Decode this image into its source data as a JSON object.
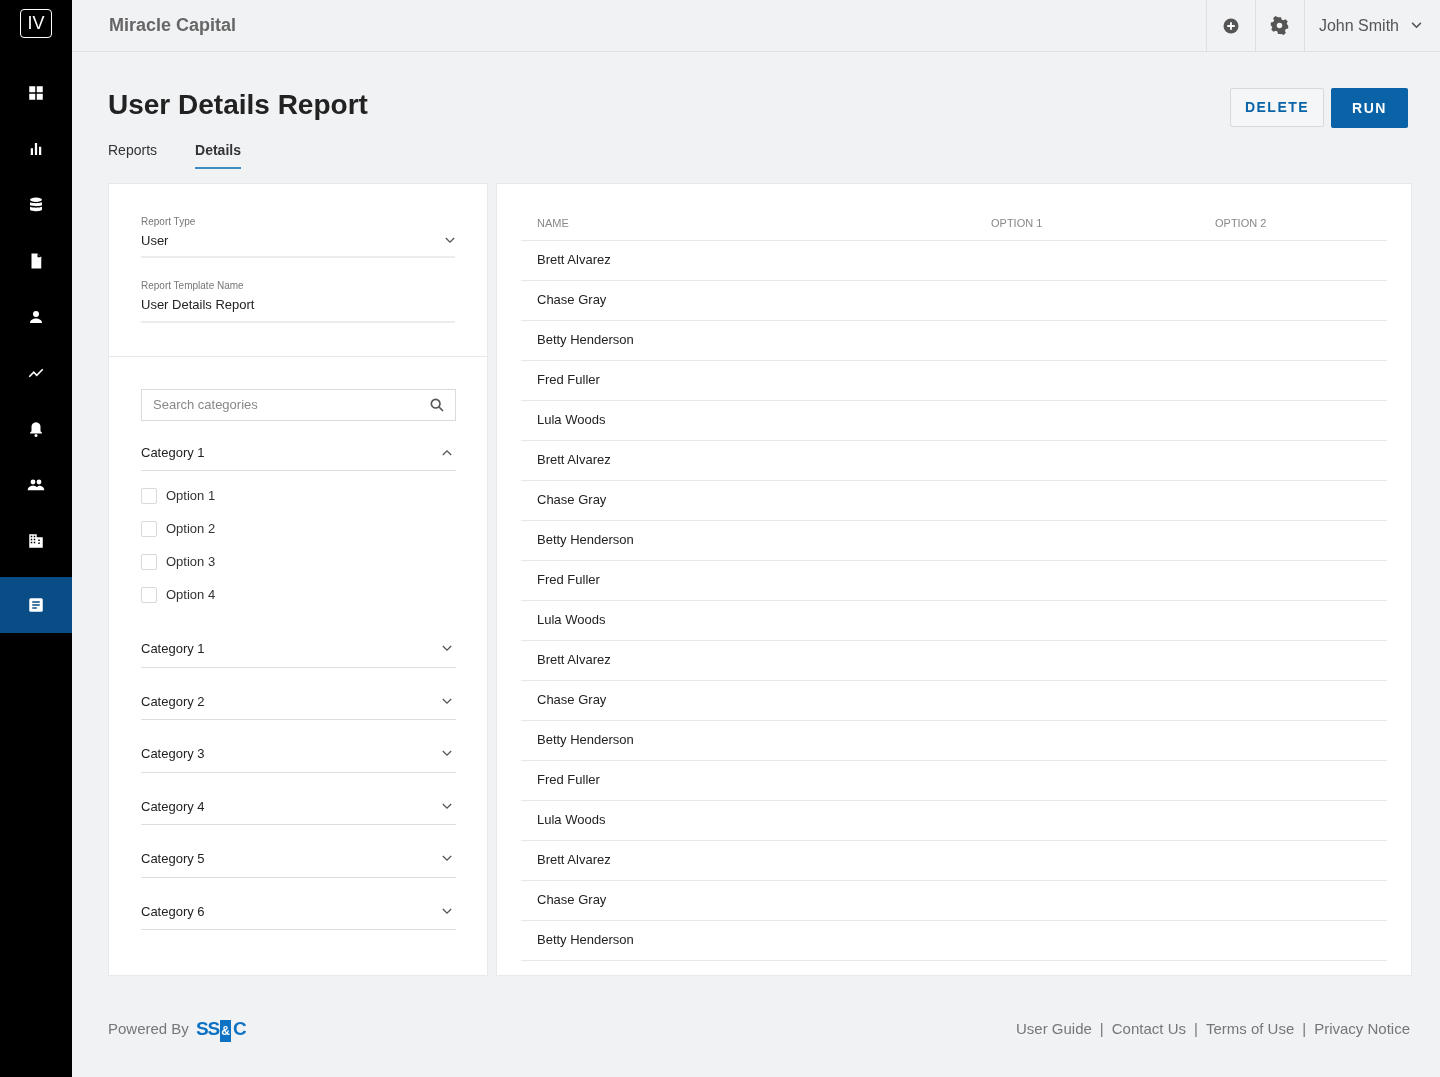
{
  "sidebar": {
    "logo": "IV",
    "items": [
      {
        "selected": false
      },
      {
        "selected": false
      },
      {
        "selected": false
      },
      {
        "selected": false
      },
      {
        "selected": false
      },
      {
        "selected": false
      },
      {
        "selected": false
      },
      {
        "selected": false
      },
      {
        "selected": false
      },
      {
        "selected": true
      }
    ]
  },
  "topbar": {
    "company": "Miracle Capital",
    "user": "John Smith"
  },
  "page": {
    "title": "User Details Report",
    "buttons": [
      {
        "label": "DELETE",
        "kind": "outline"
      },
      {
        "label": "RUN",
        "kind": "primary"
      }
    ]
  },
  "tabs": [
    {
      "label": "Reports",
      "selected": false
    },
    {
      "label": "Details",
      "selected": true
    }
  ],
  "form": {
    "fields": [
      {
        "label": "Report Type",
        "value": "User",
        "kind": "select"
      },
      {
        "label": "Report Template Name",
        "value": "User Details Report",
        "kind": "text"
      }
    ]
  },
  "search": {
    "placeholder": "Search categories"
  },
  "categories": [
    {
      "label": "Category 1",
      "expanded": true,
      "options": [
        {
          "label": "Option 1",
          "checked": false
        },
        {
          "label": "Option 2",
          "checked": false
        },
        {
          "label": "Option 3",
          "checked": false
        },
        {
          "label": "Option 4",
          "checked": false
        }
      ]
    },
    {
      "label": "Category 1",
      "expanded": false
    },
    {
      "label": "Category 2",
      "expanded": false
    },
    {
      "label": "Category 3",
      "expanded": false
    },
    {
      "label": "Category 4",
      "expanded": false
    },
    {
      "label": "Category 5",
      "expanded": false
    },
    {
      "label": "Category 6",
      "expanded": false
    }
  ],
  "table": {
    "columns": [
      "NAME",
      "OPTION 1",
      "OPTION 2"
    ],
    "rows": [
      {
        "name": "Brett Alvarez"
      },
      {
        "name": "Chase Gray"
      },
      {
        "name": "Betty Henderson"
      },
      {
        "name": "Fred Fuller"
      },
      {
        "name": "Lula Woods"
      },
      {
        "name": "Brett Alvarez"
      },
      {
        "name": "Chase Gray"
      },
      {
        "name": "Betty Henderson"
      },
      {
        "name": "Fred Fuller"
      },
      {
        "name": "Lula Woods"
      },
      {
        "name": "Brett Alvarez"
      },
      {
        "name": "Chase Gray"
      },
      {
        "name": "Betty Henderson"
      },
      {
        "name": "Fred Fuller"
      },
      {
        "name": "Lula Woods"
      },
      {
        "name": "Brett Alvarez"
      },
      {
        "name": "Chase Gray"
      },
      {
        "name": "Betty Henderson"
      }
    ]
  },
  "footer": {
    "powered_by": "Powered By",
    "logo": "SS&C",
    "separator": "|",
    "links": [
      "User Guide",
      "Contact Us",
      "Terms of Use",
      "Privacy Notice"
    ]
  }
}
